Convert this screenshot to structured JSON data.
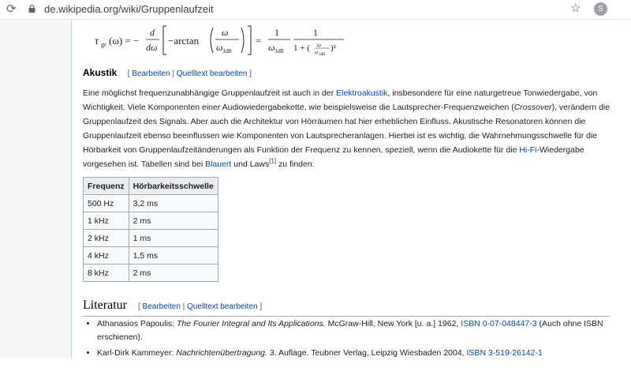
{
  "browser": {
    "url": "de.wikipedia.org/wiki/Gruppenlaufzeit",
    "avatar_letter": "S"
  },
  "section_akustik": {
    "heading": "Akustik",
    "edit_open": "[ ",
    "edit": "Bearbeiten",
    "sep": " | ",
    "edit_source": "Quelltext bearbeiten",
    "edit_close": " ]",
    "p1": "Eine möglichst frequenzunabhängige Gruppenlaufzeit ist auch in der ",
    "link_elektroakustik": "Elektroakustik",
    "p2": ", insbesondere für eine naturgetreue Tonwiedergabe, von Wichtigkeit. Viele Komponenten einer Audiowiedergabekette, wie beispielsweise die Lautsprecher-Frequenzweichen (",
    "crossover": "Crossover",
    "p3": "), verändern die Gruppenlaufzeit des Signals. Aber auch die Architektur von Hörräumen hat hier erheblichen Einfluss. Akustische Resonatoren können die Gruppenlaufzeit ebenso beeinflussen wie Komponenten von Lautsprecheranlagen. Hierbei ist es wichtig, die Wahrnehmungsschwelle für die Hörbarkeit von Gruppenlaufzeitänderungen als Funktion der Frequenz zu kennen, speziell, wenn die Audiokette für die ",
    "link_hifi": "Hi-Fi",
    "p4": "-Wiedergabe vorgesehen ist. Tabellen sind bei ",
    "link_blauert": "Blauert",
    "p5": " und Laws",
    "ref1": "[1]",
    "p6": " zu finden:"
  },
  "table": {
    "headers": [
      "Frequenz",
      "Hörbarkeitsschwelle"
    ],
    "rows": [
      [
        "500 Hz",
        "3,2 ms"
      ],
      [
        "1 kHz",
        "2 ms"
      ],
      [
        "2 kHz",
        "1 ms"
      ],
      [
        "4 kHz",
        "1,5 ms"
      ],
      [
        "8 kHz",
        "2 ms"
      ]
    ]
  },
  "section_literatur": {
    "heading": "Literatur",
    "edit_open": "[ ",
    "edit": "Bearbeiten",
    "sep": " | ",
    "edit_source": "Quelltext bearbeiten",
    "edit_close": " ]",
    "ref1_author": "Athanasios Papoulis: ",
    "ref1_title": "The Fourier Integral and Its Applications.",
    "ref1_rest": " McGraw-Hill, New York [u. a.] 1962, ",
    "ref1_isbn": "ISBN 0-07-048447-3",
    "ref1_note": " (Auch ohne ISBN erschienen).",
    "ref2_author": "Karl-Dirk Kammeyer: ",
    "ref2_title": "Nachrichtenübertragung.",
    "ref2_rest": " 3. Auflage. Teubner Verlag, Leipzig Wiesbaden 2004, ",
    "ref2_isbn": "ISBN 3-519-26142-1"
  },
  "formula": {
    "tau": "τ",
    "gr": "gr",
    "omega_arg": "(ω) = −",
    "d": "d",
    "domega": "dω",
    "arctan": "−arctan",
    "omega": "ω",
    "omega3db": "ω",
    "sub3db": "3dB",
    "equals": "=",
    "one": "1",
    "one_plus": "1 + (",
    "close_sq": ")²",
    "small_omega": "ω",
    "small_omega3db": "ω",
    "small_3db": "3dB"
  }
}
